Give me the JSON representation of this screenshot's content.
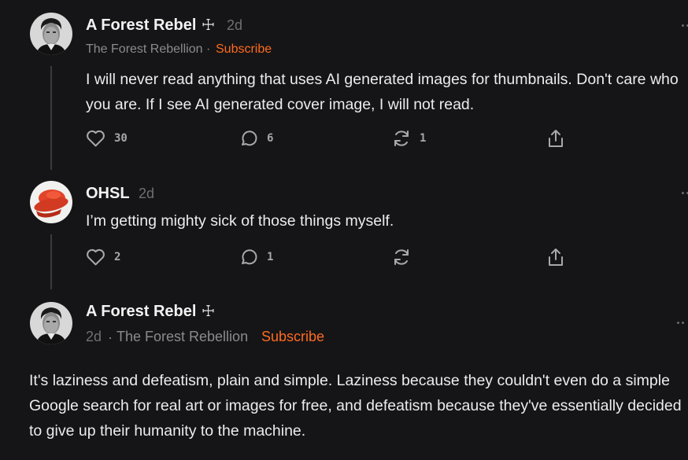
{
  "comments": [
    {
      "author": "A Forest Rebel",
      "author_symbol": "☩",
      "age": "2d",
      "publication": "The Forest Rebellion",
      "separator": "·",
      "subscribe_label": "Subscribe",
      "text": "I will never read anything that uses AI generated images for thumbnails. Don't care who you are. If I see AI generated cover image, I will not read.",
      "likes": "30",
      "replies": "6",
      "restacks": "1",
      "icons": [
        "heart-icon",
        "comment-bubble-icon",
        "restack-icon",
        "share-icon",
        "more-icon"
      ]
    },
    {
      "author": "OHSL",
      "age": "2d",
      "text": "I’m getting mighty sick of those things myself.",
      "likes": "2",
      "replies": "1",
      "restacks": "",
      "icons": [
        "heart-icon",
        "comment-bubble-icon",
        "restack-icon",
        "share-icon",
        "more-icon"
      ]
    },
    {
      "author": "A Forest Rebel",
      "author_symbol": "☩",
      "age": "2d",
      "separator": "·",
      "publication": "The Forest Rebellion",
      "subscribe_label": "Subscribe",
      "text": "It's laziness and defeatism, plain and simple. Laziness because they couldn't even do a simple Google search for real art or images for free, and defeatism because they've essentially decided to give up their humanity to the machine.",
      "icons": [
        "more-icon"
      ]
    }
  ],
  "colors": {
    "background": "#151517",
    "accent_subscribe": "#ff6a1f",
    "muted_text": "#8b8b8e",
    "thread_line": "#3a3a3d"
  }
}
